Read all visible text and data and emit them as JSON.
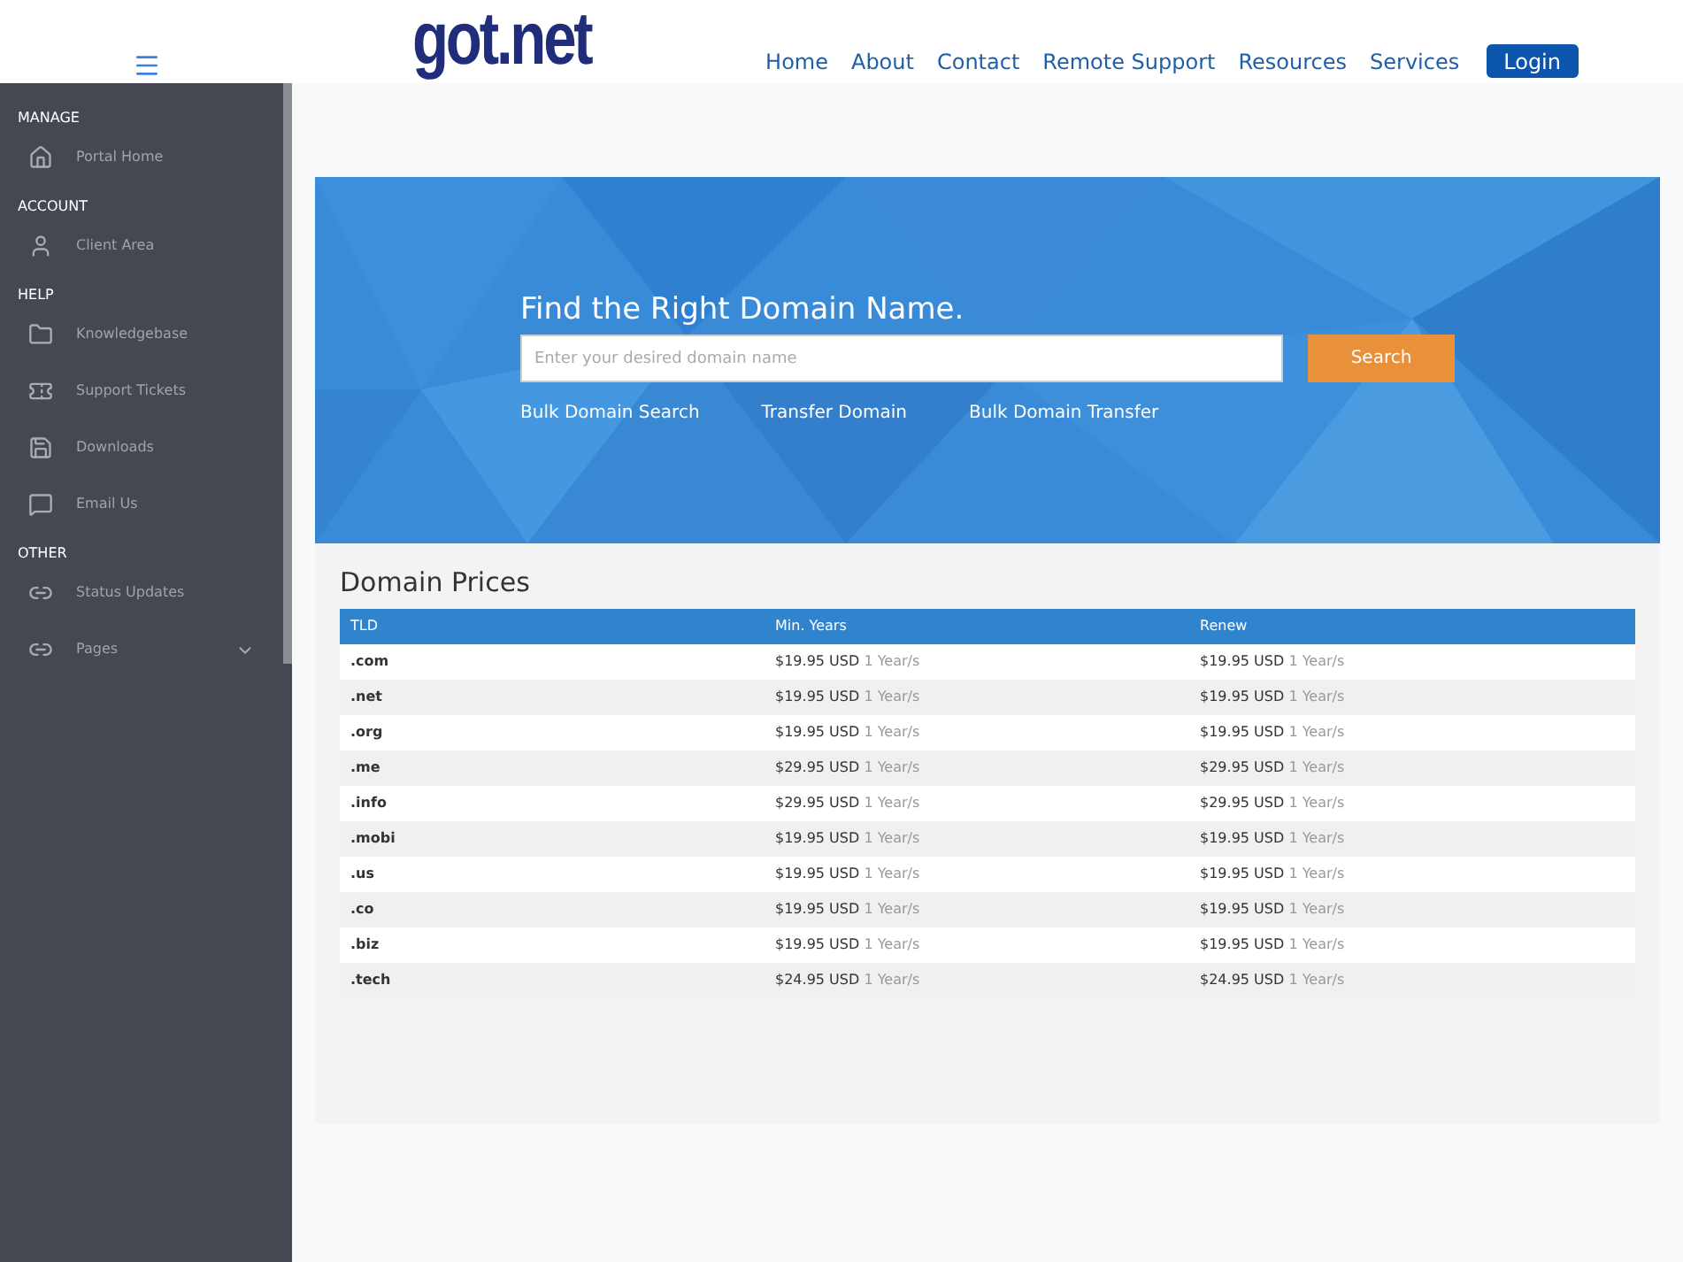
{
  "header": {
    "logo": "got.net",
    "nav": [
      {
        "label": "Home"
      },
      {
        "label": "About"
      },
      {
        "label": "Contact"
      },
      {
        "label": "Remote Support"
      },
      {
        "label": "Resources"
      },
      {
        "label": "Services"
      }
    ],
    "login": "Login"
  },
  "sidebar": {
    "sections": [
      {
        "title": "MANAGE",
        "items": [
          {
            "label": "Portal Home"
          }
        ]
      },
      {
        "title": "ACCOUNT",
        "items": [
          {
            "label": "Client Area"
          }
        ]
      },
      {
        "title": "HELP",
        "items": [
          {
            "label": "Knowledgebase"
          },
          {
            "label": "Support Tickets"
          },
          {
            "label": "Downloads"
          },
          {
            "label": "Email Us"
          }
        ]
      },
      {
        "title": "OTHER",
        "items": [
          {
            "label": "Status Updates"
          },
          {
            "label": "Pages",
            "expanded": false
          }
        ]
      }
    ]
  },
  "search": {
    "title": "Find the Right Domain Name.",
    "placeholder": "Enter your desired domain name",
    "button": "Search",
    "links": [
      "Bulk Domain Search",
      "Transfer Domain",
      "Bulk Domain Transfer"
    ]
  },
  "prices": {
    "title": "Domain Prices",
    "columns": [
      "TLD",
      "Min. Years",
      "Renew"
    ],
    "rows": [
      {
        "tld": ".com",
        "min": "$19.95 USD",
        "min_term": "1 Year/s",
        "renew": "$19.95 USD",
        "renew_term": "1 Year/s"
      },
      {
        "tld": ".net",
        "min": "$19.95 USD",
        "min_term": "1 Year/s",
        "renew": "$19.95 USD",
        "renew_term": "1 Year/s"
      },
      {
        "tld": ".org",
        "min": "$19.95 USD",
        "min_term": "1 Year/s",
        "renew": "$19.95 USD",
        "renew_term": "1 Year/s"
      },
      {
        "tld": ".me",
        "min": "$29.95 USD",
        "min_term": "1 Year/s",
        "renew": "$29.95 USD",
        "renew_term": "1 Year/s"
      },
      {
        "tld": ".info",
        "min": "$29.95 USD",
        "min_term": "1 Year/s",
        "renew": "$29.95 USD",
        "renew_term": "1 Year/s"
      },
      {
        "tld": ".mobi",
        "min": "$19.95 USD",
        "min_term": "1 Year/s",
        "renew": "$19.95 USD",
        "renew_term": "1 Year/s"
      },
      {
        "tld": ".us",
        "min": "$19.95 USD",
        "min_term": "1 Year/s",
        "renew": "$19.95 USD",
        "renew_term": "1 Year/s"
      },
      {
        "tld": ".co",
        "min": "$19.95 USD",
        "min_term": "1 Year/s",
        "renew": "$19.95 USD",
        "renew_term": "1 Year/s"
      },
      {
        "tld": ".biz",
        "min": "$19.95 USD",
        "min_term": "1 Year/s",
        "renew": "$19.95 USD",
        "renew_term": "1 Year/s"
      },
      {
        "tld": ".tech",
        "min": "$24.95 USD",
        "min_term": "1 Year/s",
        "renew": "$24.95 USD",
        "renew_term": "1 Year/s"
      }
    ]
  }
}
